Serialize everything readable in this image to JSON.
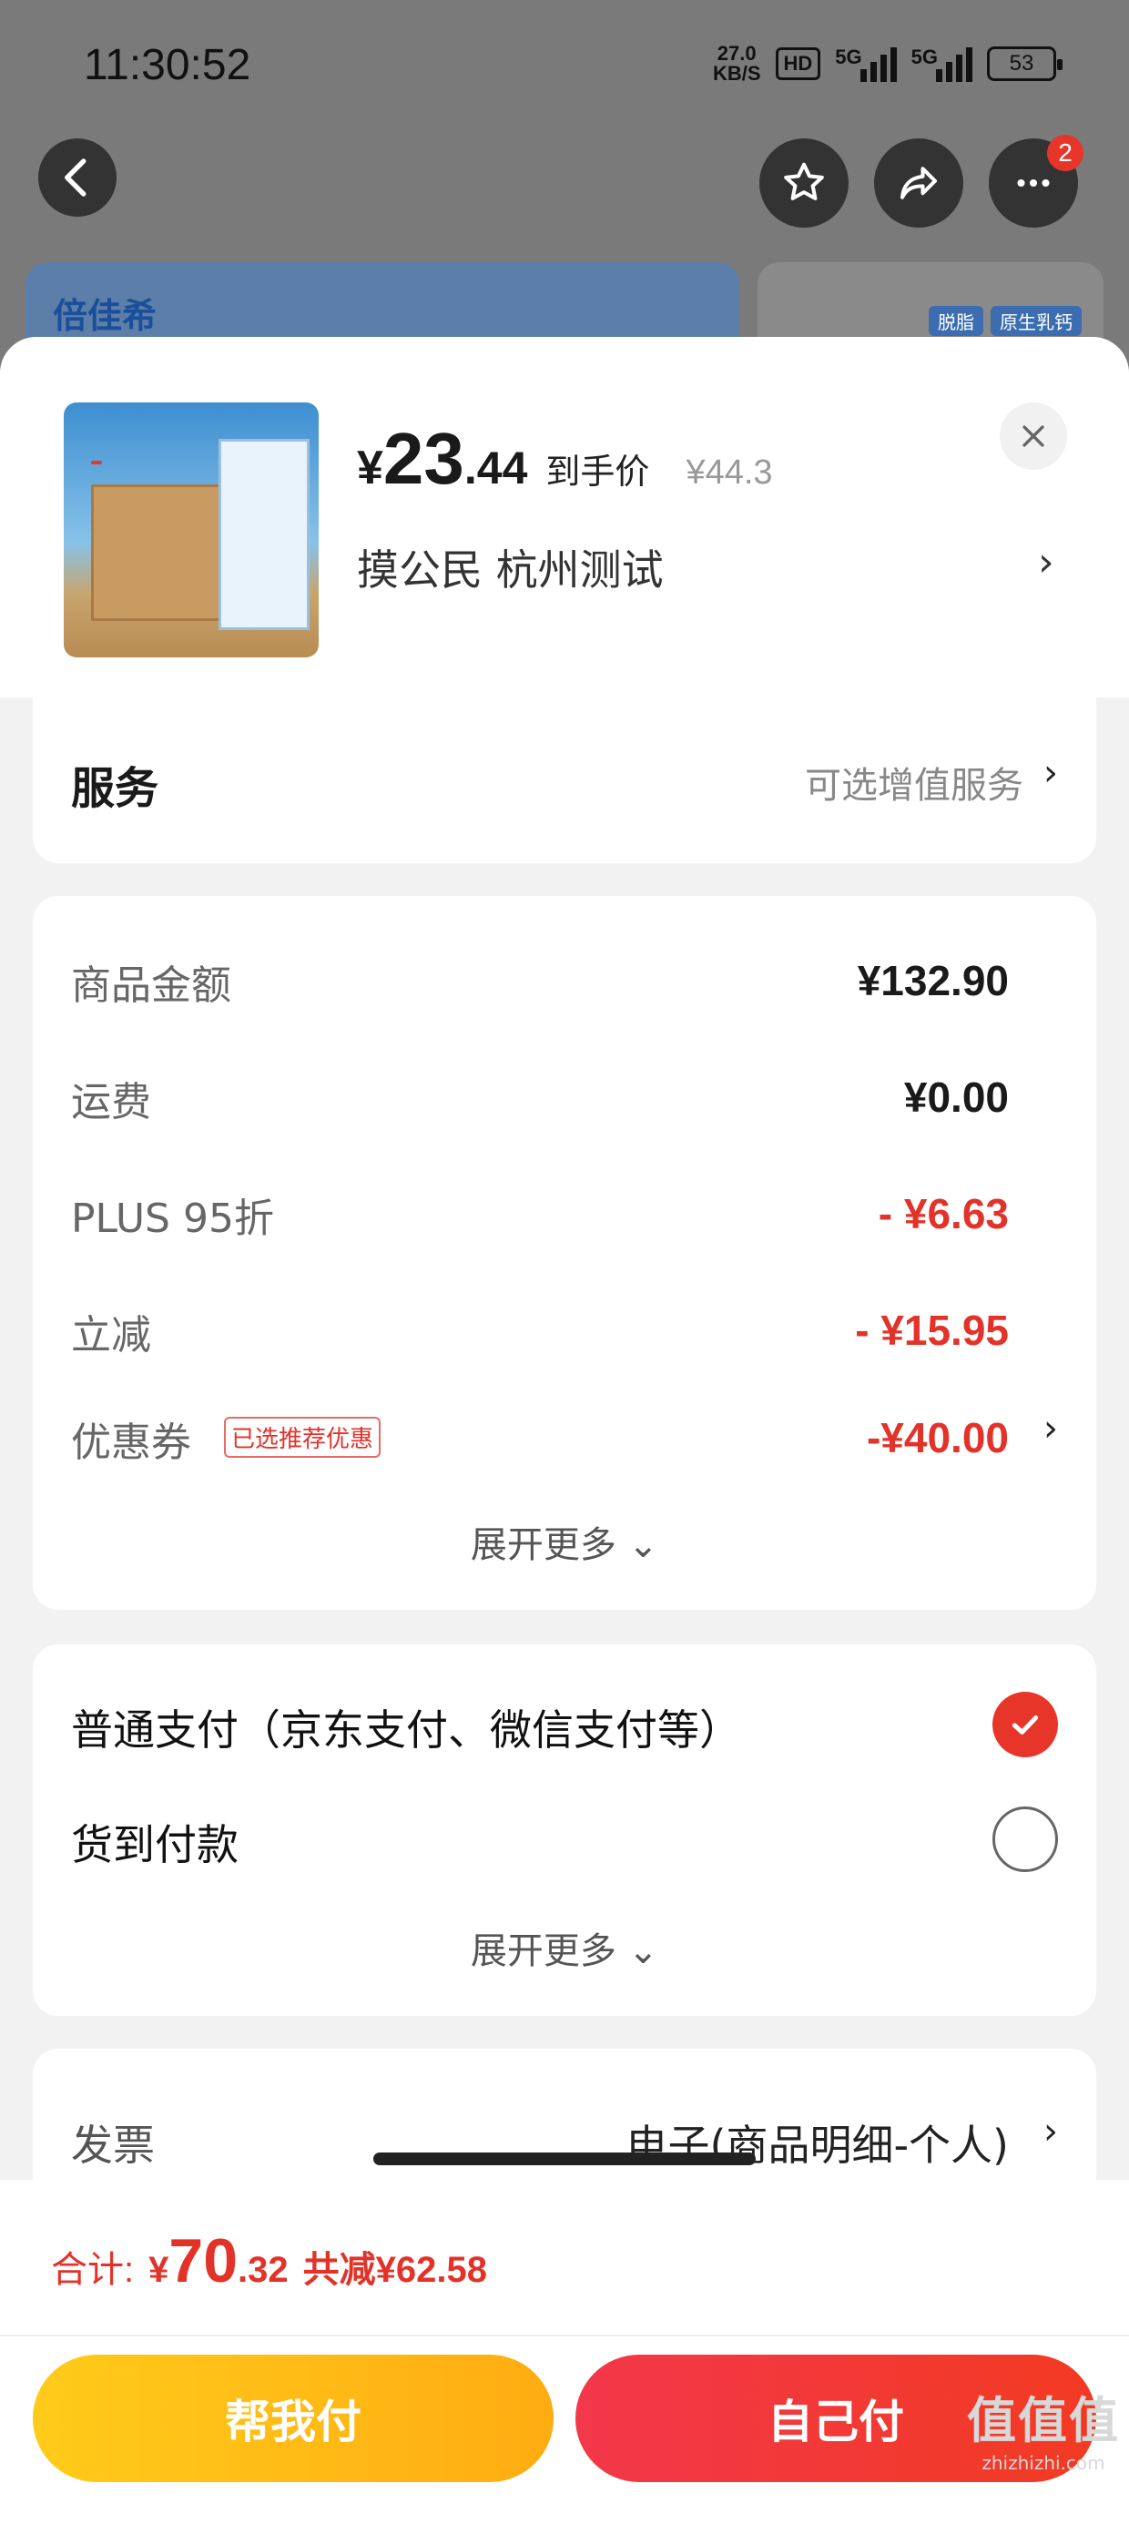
{
  "status_bar": {
    "time": "11:30:52",
    "net_speed_value": "27.0",
    "net_speed_unit": "KB/S",
    "hd_label": "HD",
    "signal1_label": "5G",
    "signal2_label": "5G",
    "battery": "53"
  },
  "top_nav": {
    "more_badge": "2"
  },
  "background": {
    "brand": "倍佳希",
    "tags": [
      "脱脂",
      "原生乳钙"
    ]
  },
  "product": {
    "price_symbol": "¥",
    "price_int": "23",
    "price_dec": ".44",
    "price_label": "到手价",
    "original_price": "¥44.3",
    "address": "摸公民  杭州测试"
  },
  "service": {
    "title": "服务",
    "value": "可选增值服务"
  },
  "amounts": {
    "rows": [
      {
        "label": "商品金额",
        "value": "¥132.90"
      },
      {
        "label": "运费",
        "value": "¥0.00"
      },
      {
        "label": "PLUS 95折",
        "value": "- ¥6.63"
      },
      {
        "label": "立减",
        "value": "- ¥15.95"
      },
      {
        "label": "优惠券",
        "value": "-¥40.00"
      }
    ],
    "coupon_tag": "已选推荐优惠",
    "expand": "展开更多"
  },
  "payment": {
    "options": [
      {
        "label": "普通支付（京东支付、微信支付等）",
        "selected": true
      },
      {
        "label": "货到付款",
        "selected": false
      }
    ],
    "expand": "展开更多"
  },
  "invoice": {
    "label": "发票",
    "value": "电子(商品明细-个人)"
  },
  "checkout": {
    "total_label": "合计:",
    "total_symbol": "¥",
    "total_int": "70",
    "total_dec": ".32",
    "saved": "共减¥62.58",
    "help_pay": "帮我付",
    "self_pay": "自己付"
  },
  "watermark": {
    "big": "值值值",
    "small": "zhizhizhi.com"
  },
  "colors": {
    "accent_red": "#e2332a",
    "yellow_button": "#ffb812",
    "red_button": "#f23a2e"
  }
}
